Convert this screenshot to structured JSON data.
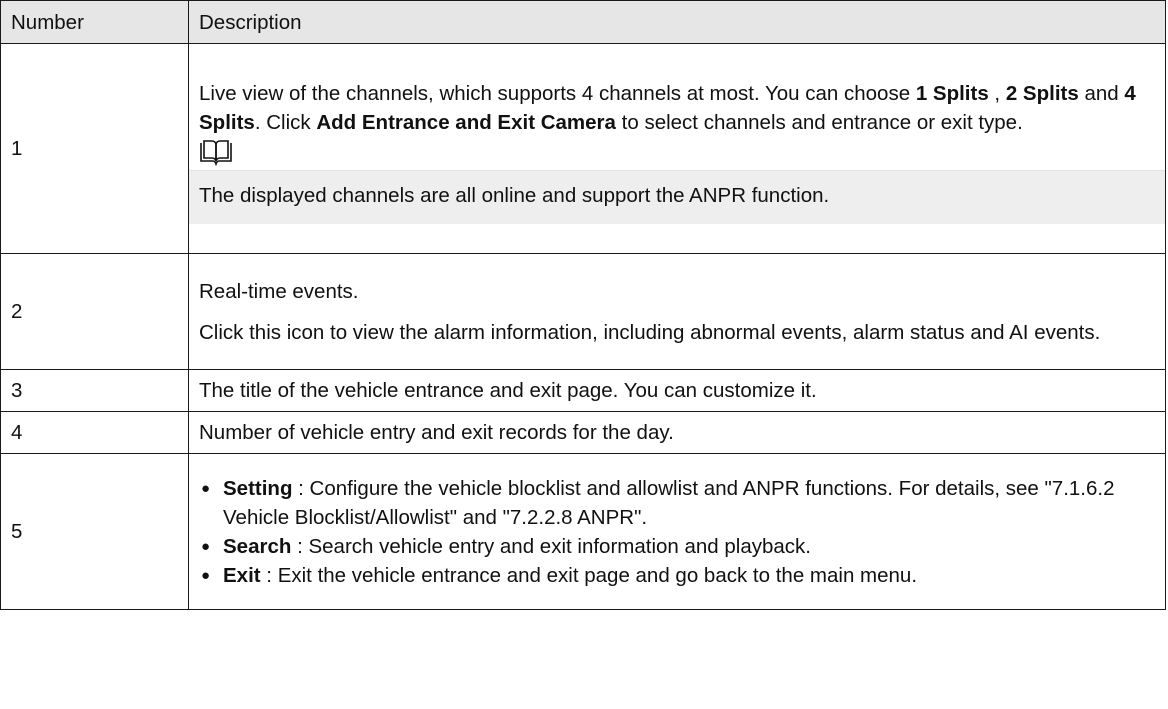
{
  "header": {
    "number": "Number",
    "description": "Description"
  },
  "rows": [
    {
      "number": "1",
      "text_a": "Live view of the channels, which supports 4 channels at most. You can choose ",
      "b1": "1 Splits",
      "text_b": " , ",
      "b2": "2 Splits",
      "text_c": " and ",
      "b3": "4 Splits",
      "text_d": ". Click ",
      "b4": "Add Entrance and Exit Camera",
      "text_e": " to select channels and entrance or exit type.",
      "note_icon": "book-icon",
      "note": "The displayed channels are all online and support the ANPR function."
    },
    {
      "number": "2",
      "p1": "Real-time events.",
      "p2": "Click this icon to view the alarm information, including abnormal events, alarm status and AI events."
    },
    {
      "number": "3",
      "p1": "The title of the vehicle entrance and exit page. You can customize it."
    },
    {
      "number": "4",
      "p1": "Number of vehicle entry and exit records for the day."
    },
    {
      "number": "5",
      "bullets": [
        {
          "term": "Setting",
          "text": " : Configure the vehicle blocklist and allowlist and ANPR functions. For details, see \"7.1.6.2 Vehicle Blocklist/Allowlist\" and \"7.2.2.8 ANPR\"."
        },
        {
          "term": "Search",
          "text": " : Search vehicle entry and exit information and playback."
        },
        {
          "term": "Exit",
          "text": " : Exit the vehicle entrance and exit page and go back to the main menu."
        }
      ]
    }
  ]
}
